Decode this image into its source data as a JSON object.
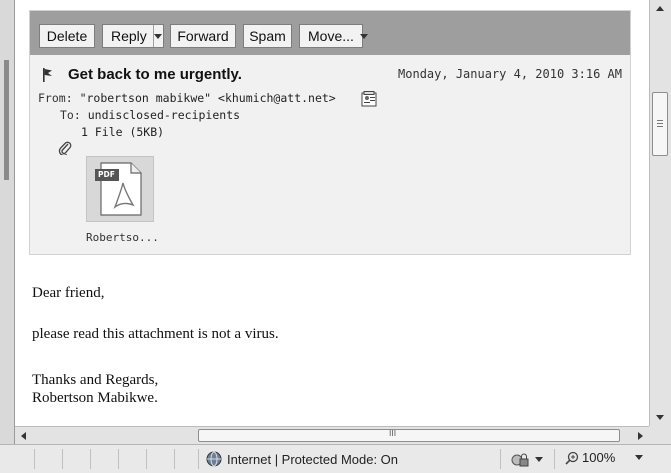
{
  "toolbar": {
    "delete_label": "Delete",
    "reply_label": "Reply",
    "forward_label": "Forward",
    "spam_label": "Spam",
    "move_label": "Move..."
  },
  "message": {
    "subject": "Get back to me urgently.",
    "date": "Monday, January 4, 2010 3:16 AM",
    "from_label": "From:",
    "from_value": "\"robertson mabikwe\" <khumich@att.net>",
    "to_label": "To:",
    "to_value": "undisclosed-recipients",
    "attachment_summary": "1 File (5KB)",
    "attachment_badge": "PDF",
    "attachment_name": "Robertso..."
  },
  "body": {
    "line1": "Dear friend,",
    "line2": "please read this attachment is not a virus.",
    "line3": "Thanks and Regards,",
    "line4": "Robertson Mabikwe."
  },
  "hscroll": {
    "grip": "III"
  },
  "statusbar": {
    "zone_text": "Internet | Protected Mode: On",
    "zoom": "100%"
  },
  "icons": {
    "flag": "flag-icon",
    "address_book": "address-book-icon",
    "attachment": "paperclip-icon",
    "pdf": "pdf-file-icon",
    "globe": "globe-icon",
    "lock": "security-lock-icon",
    "zoom": "zoom-magnifier-icon"
  },
  "colors": {
    "toolbar_bg": "#9e9e9e",
    "card_bg": "#f1f1f1",
    "pdf_badge": "#555555"
  }
}
